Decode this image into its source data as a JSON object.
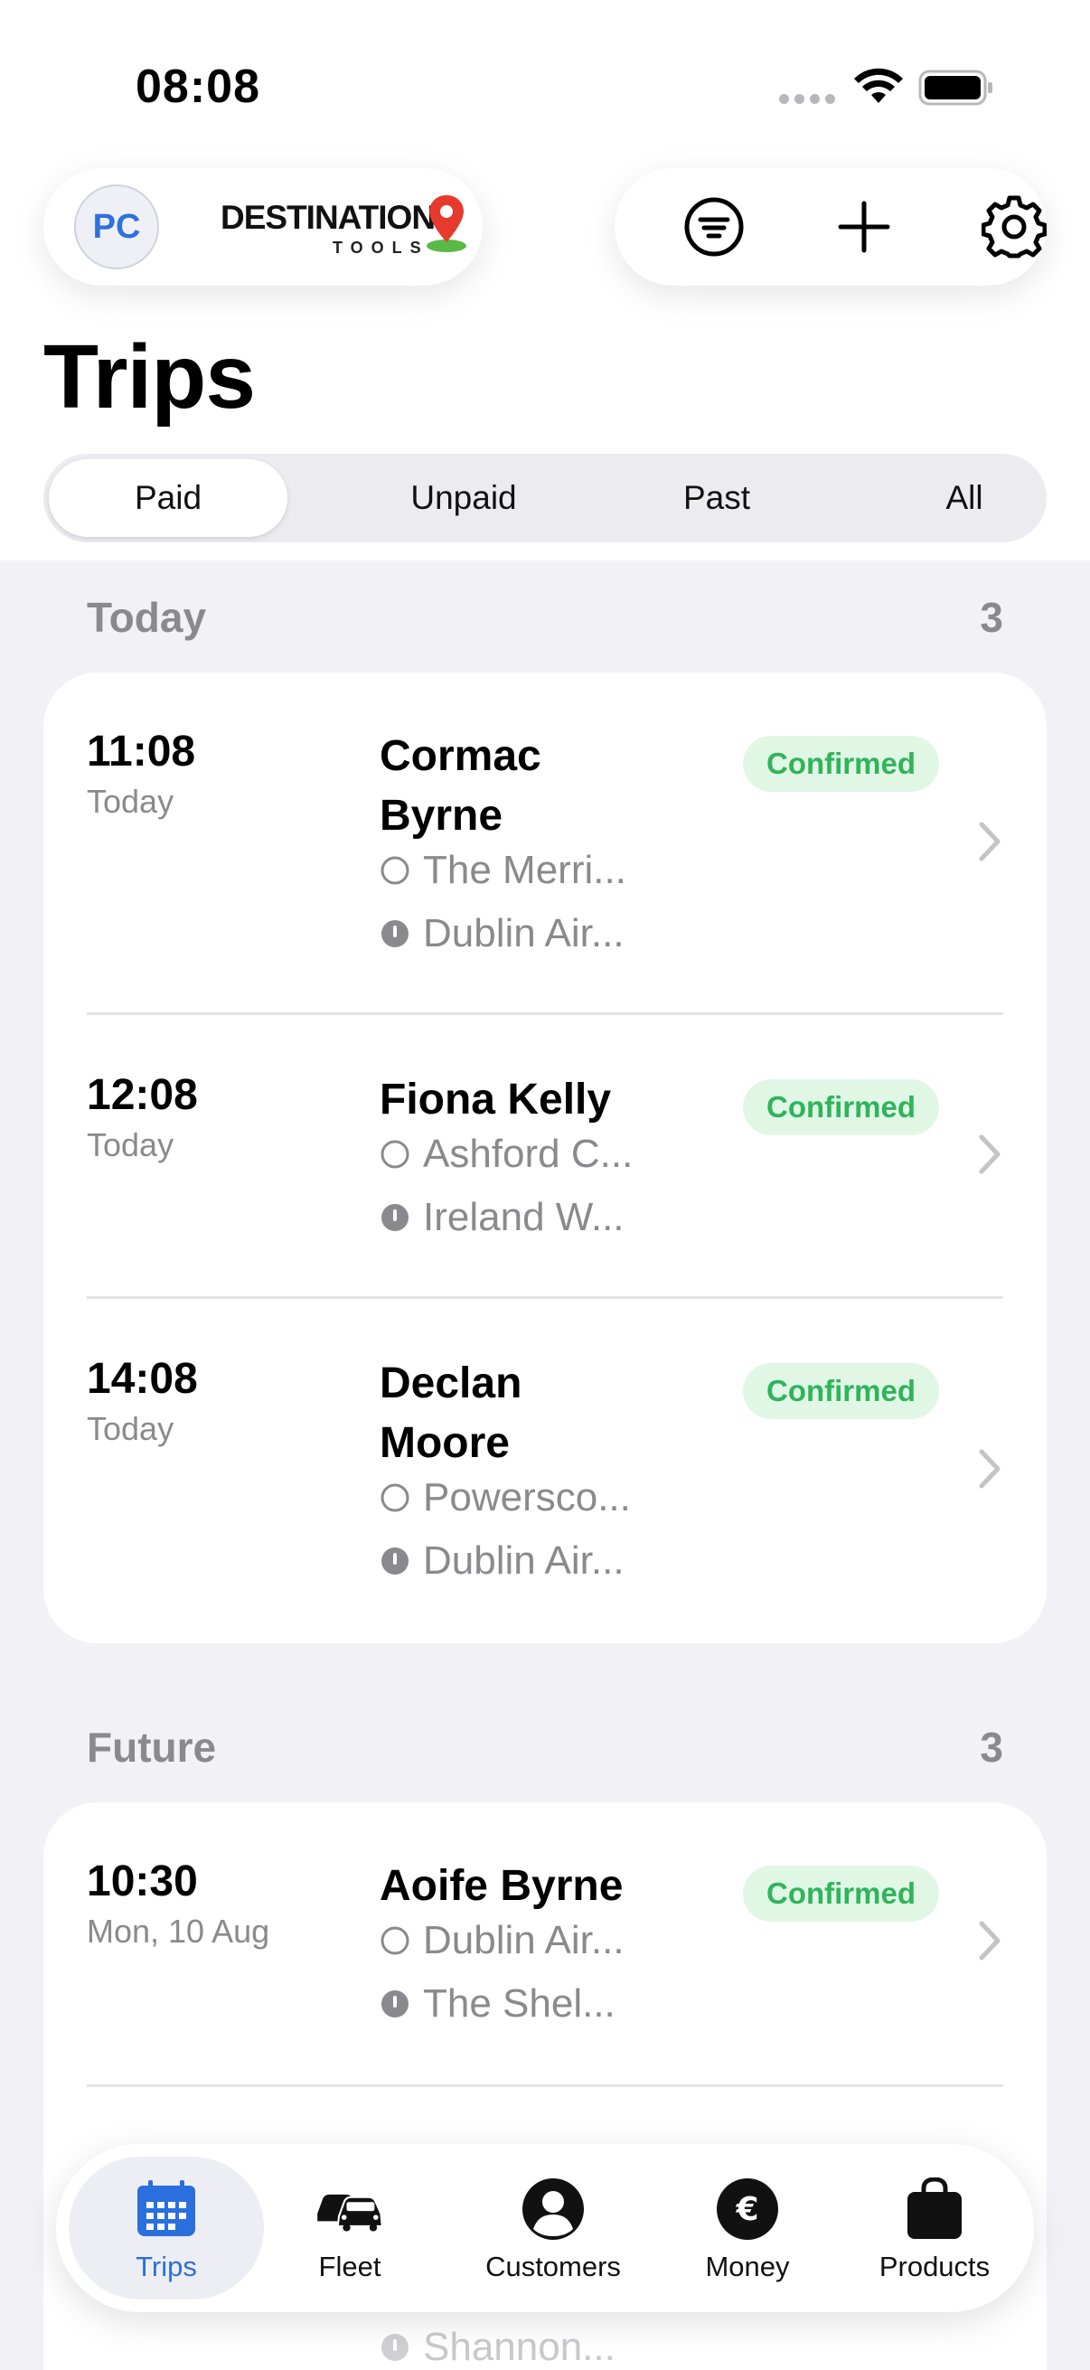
{
  "status_bar": {
    "time": "08:08"
  },
  "header": {
    "avatar_initials": "PC",
    "logo_word": "DESTINATION",
    "logo_sub": "TOOLS",
    "buttons": [
      "filter-icon",
      "plus-icon",
      "gear-icon"
    ]
  },
  "page_title": "Trips",
  "segments": [
    {
      "label": "Paid",
      "selected": true
    },
    {
      "label": "Unpaid",
      "selected": false
    },
    {
      "label": "Past",
      "selected": false
    },
    {
      "label": "All",
      "selected": false
    }
  ],
  "sections": [
    {
      "title": "Today",
      "count": "3",
      "trips": [
        {
          "time": "11:08",
          "date": "Today",
          "name_line1": "Cormac",
          "name_line2": "Byrne",
          "from": "The Merri...",
          "to": "Dublin Air...",
          "status": "Confirmed"
        },
        {
          "time": "12:08",
          "date": "Today",
          "name_line1": "Fiona Kelly",
          "name_line2": "",
          "from": "Ashford C...",
          "to": "Ireland W...",
          "status": "Confirmed"
        },
        {
          "time": "14:08",
          "date": "Today",
          "name_line1": "Declan",
          "name_line2": "Moore",
          "from": "Powersco...",
          "to": "Dublin Air...",
          "status": "Confirmed"
        }
      ]
    },
    {
      "title": "Future",
      "count": "3",
      "trips": [
        {
          "time": "10:30",
          "date": "Mon, 10 Aug",
          "name_line1": "Aoife Byrne",
          "name_line2": "",
          "from": "Dublin Air...",
          "to": "The Shel...",
          "status": "Confirmed"
        }
      ]
    }
  ],
  "peek_text": "Shannon...",
  "tabbar": [
    {
      "label": "Trips",
      "icon": "calendar-icon",
      "active": true
    },
    {
      "label": "Fleet",
      "icon": "car-icon",
      "active": false
    },
    {
      "label": "Customers",
      "icon": "person-icon",
      "active": false
    },
    {
      "label": "Money",
      "icon": "euro-icon",
      "active": false
    },
    {
      "label": "Products",
      "icon": "bag-icon",
      "active": false
    }
  ],
  "colors": {
    "accent": "#2b6fde",
    "confirmed_text": "#2fb45a",
    "confirmed_bg": "#e1f7e6",
    "list_bg": "#f2f2f6"
  }
}
